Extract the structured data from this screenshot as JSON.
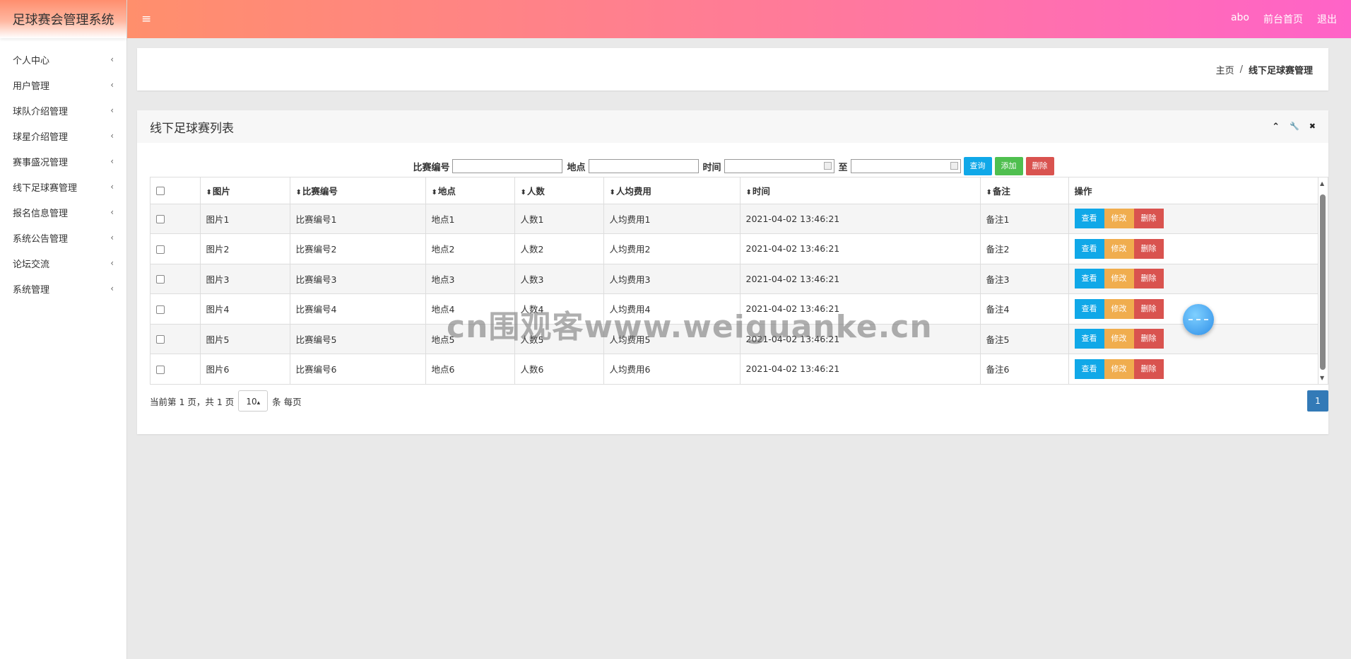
{
  "sidebar": {
    "brand": "足球赛会管理系统",
    "items": [
      {
        "label": "个人中心"
      },
      {
        "label": "用户管理"
      },
      {
        "label": "球队介绍管理"
      },
      {
        "label": "球星介绍管理"
      },
      {
        "label": "赛事盛况管理"
      },
      {
        "label": "线下足球赛管理"
      },
      {
        "label": "报名信息管理"
      },
      {
        "label": "系统公告管理"
      },
      {
        "label": "论坛交流"
      },
      {
        "label": "系统管理"
      }
    ],
    "chevron": "‹"
  },
  "topbar": {
    "menu_icon": "≡",
    "user": "abo",
    "front_home": "前台首页",
    "logout": "退出"
  },
  "breadcrumb": {
    "home": "主页",
    "separator": "/",
    "current": "线下足球赛管理"
  },
  "panel": {
    "title": "线下足球赛列表",
    "tool_collapse": "⌃",
    "tool_wrench": "🔧",
    "tool_close": "✖"
  },
  "search": {
    "match_no_label": "比赛编号",
    "match_no_value": "",
    "location_label": "地点",
    "location_value": "",
    "time_label": "时间",
    "time_from_value": "",
    "to_label": "至",
    "time_to_value": "",
    "query_button": "查询",
    "add_button": "添加",
    "delete_button": "删除"
  },
  "table": {
    "sort_icon": "⬍",
    "headers": {
      "image": "图片",
      "match_no": "比赛编号",
      "location": "地点",
      "people": "人数",
      "fee": "人均费用",
      "time": "时间",
      "note": "备注",
      "actions": "操作"
    },
    "rows": [
      {
        "image": "图片1",
        "match_no": "比赛编号1",
        "location": "地点1",
        "people": "人数1",
        "fee": "人均费用1",
        "time": "2021-04-02 13:46:21",
        "note": "备注1"
      },
      {
        "image": "图片2",
        "match_no": "比赛编号2",
        "location": "地点2",
        "people": "人数2",
        "fee": "人均费用2",
        "time": "2021-04-02 13:46:21",
        "note": "备注2"
      },
      {
        "image": "图片3",
        "match_no": "比赛编号3",
        "location": "地点3",
        "people": "人数3",
        "fee": "人均费用3",
        "time": "2021-04-02 13:46:21",
        "note": "备注3"
      },
      {
        "image": "图片4",
        "match_no": "比赛编号4",
        "location": "地点4",
        "people": "人数4",
        "fee": "人均费用4",
        "time": "2021-04-02 13:46:21",
        "note": "备注4"
      },
      {
        "image": "图片5",
        "match_no": "比赛编号5",
        "location": "地点5",
        "people": "人数5",
        "fee": "人均费用5",
        "time": "2021-04-02 13:46:21",
        "note": "备注5"
      },
      {
        "image": "图片6",
        "match_no": "比赛编号6",
        "location": "地点6",
        "people": "人数6",
        "fee": "人均费用6",
        "time": "2021-04-02 13:46:21",
        "note": "备注6"
      }
    ],
    "action_view": "查看",
    "action_edit": "修改",
    "action_delete": "删除"
  },
  "pager": {
    "info": "当前第 1 页，共 1 页",
    "page_size": "10",
    "page_size_caret": "▴",
    "per_page": "条 每页",
    "current_page": "1"
  },
  "watermark": "cn围观客www.weiguanke.cn",
  "colors": {
    "topbar_start": "#ff8f6c",
    "topbar_end": "#ff63c8",
    "btn_blue": "#10a8e8",
    "btn_green": "#4fbf4f",
    "btn_red": "#d9534f",
    "btn_orange": "#f0ad4e",
    "page_active": "#337ab7"
  }
}
